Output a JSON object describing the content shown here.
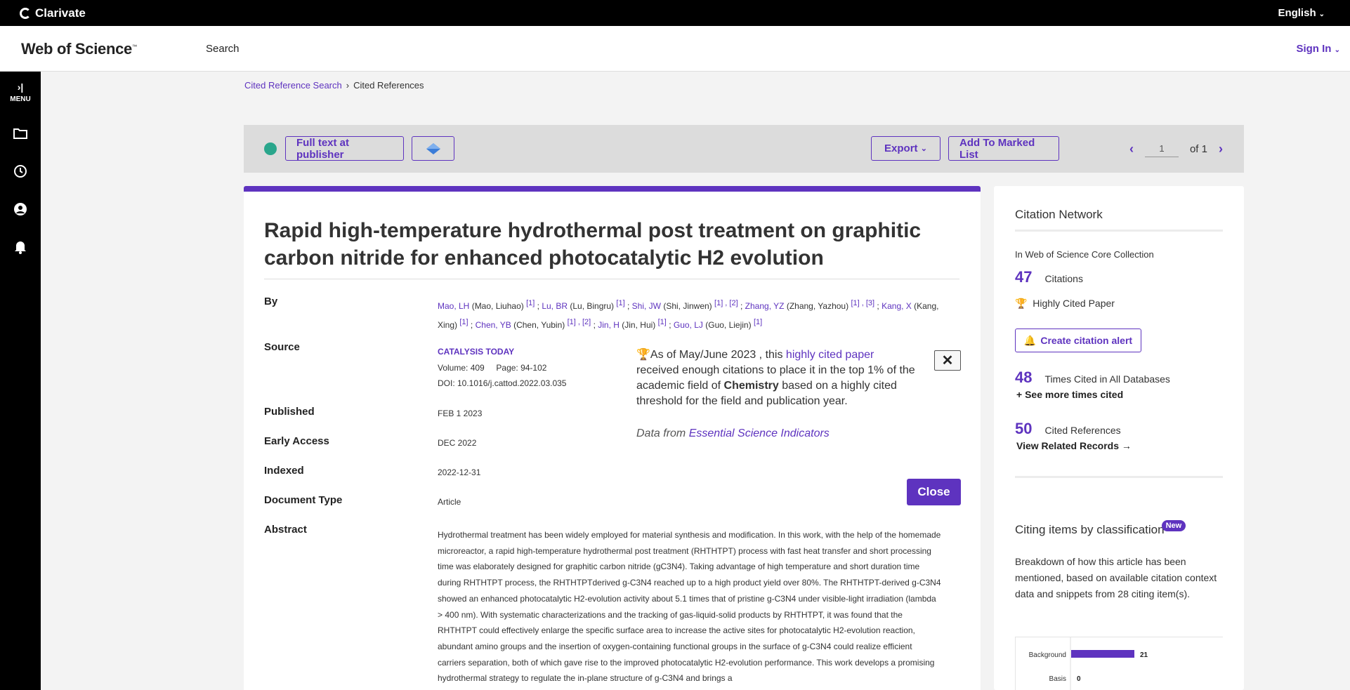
{
  "topbar": {
    "brand": "Clarivate",
    "language": "English"
  },
  "header": {
    "logo": "Web of Science",
    "logo_tm": "™",
    "search": "Search",
    "sign_in": "Sign In"
  },
  "sidebar": {
    "menu_label": "MENU",
    "icons": [
      "folder-icon",
      "history-icon",
      "account-icon",
      "bell-icon"
    ]
  },
  "breadcrumb": {
    "items": [
      "Cited Reference Search",
      "Cited References"
    ]
  },
  "toolbar": {
    "full_text": "Full text at publisher",
    "export": "Export",
    "add_marked": "Add To Marked List",
    "page_value": "1",
    "page_of": "of 1"
  },
  "record": {
    "title": "Rapid high-temperature hydrothermal post treatment on graphitic carbon nitride for enhanced photocatalytic H2 evolution",
    "labels": {
      "by": "By",
      "source": "Source",
      "published": "Published",
      "early_access": "Early Access",
      "indexed": "Indexed",
      "doc_type": "Document Type",
      "abstract": "Abstract"
    },
    "authors": [
      {
        "short": "Mao, LH",
        "full": "(Mao, Liuhao)",
        "refs": "[1]"
      },
      {
        "short": "Lu, BR",
        "full": "(Lu, Bingru)",
        "refs": "[1]"
      },
      {
        "short": "Shi, JW",
        "full": "(Shi, Jinwen)",
        "refs": "[1] , [2]"
      },
      {
        "short": "Zhang, YZ",
        "full": "(Zhang, Yazhou)",
        "refs": "[1] , [3]"
      },
      {
        "short": "Kang, X",
        "full": "(Kang, Xing)",
        "refs": "[1]"
      },
      {
        "short": "Chen, YB",
        "full": "(Chen, Yubin)",
        "refs": "[1] , [2]"
      },
      {
        "short": "Jin, H",
        "full": "(Jin, Hui)",
        "refs": "[1]"
      },
      {
        "short": "Guo, LJ",
        "full": "(Guo, Liejin)",
        "refs": "[1]"
      }
    ],
    "journal": "CATALYSIS TODAY",
    "volume": "Volume: 409",
    "pages": "Page: 94-102",
    "doi": "DOI: 10.1016/j.cattod.2022.03.035",
    "published": "FEB 1 2023",
    "early_access": "DEC 2022",
    "indexed": "2022-12-31",
    "doc_type": "Article",
    "abstract": "Hydrothermal treatment has been widely employed for material synthesis and modification. In this work, with the help of the homemade microreactor, a rapid high-temperature hydrothermal post treatment (RHTHTPT) process with fast heat transfer and short processing time was elaborately designed for graphitic carbon nitride (gC3N4). Taking advantage of high temperature and short duration time during RHTHTPT process, the RHTHTPTderived g-C3N4 reached up to a high product yield over 80%. The RHTHTPT-derived g-C3N4 showed an enhanced photocatalytic H2-evolution activity about 5.1 times that of pristine g-C3N4 under visible-light irradiation (lambda > 400 nm). With systematic characterizations and the tracking of gas-liquid-solid products by RHTHTPT, it was found that the RHTHTPT could effectively enlarge the specific surface area to increase the active sites for photocatalytic H2-evolution reaction, abundant amino groups and the insertion of oxygen-containing functional groups in the surface of g-C3N4 could realize efficient carriers separation, both of which gave rise to the improved photocatalytic H2-evolution performance. This work develops a promising hydrothermal strategy to regulate the in-plane structure of g-C3N4 and brings a"
  },
  "highly_cited_popup": {
    "lead": "As of May/June 2023 , this ",
    "link": "highly cited paper",
    "mid": " received enough citations to place it in the top 1% of the academic field of ",
    "field": "Chemistry",
    "tail": " based on a highly cited threshold for the field and publication year.",
    "data_from": "Data from ",
    "esi": "Essential Science Indicators",
    "close_x": "✕",
    "close": "Close"
  },
  "citation_network": {
    "title": "Citation Network",
    "collection": "In Web of Science Core Collection",
    "citations_num": "47",
    "citations_label": "Citations",
    "highly_cited": "Highly Cited Paper",
    "create_alert": "Create citation alert",
    "times_cited_num": "48",
    "times_cited_label": "Times Cited in All Databases",
    "see_more": "+  See more times cited",
    "cited_refs_num": "50",
    "cited_refs_label": "Cited References",
    "view_related": "View Related Records →",
    "classification_title": "Citing items by classification",
    "new_badge": "New",
    "classification_desc": "Breakdown of how this article has been mentioned, based on available citation context data and snippets from 28 citing item(s)."
  },
  "chart_data": {
    "type": "bar",
    "categories": [
      "Background",
      "Basis"
    ],
    "values": [
      21,
      0
    ],
    "title": "",
    "xlabel": "",
    "ylabel": ""
  },
  "colors": {
    "accent": "#5e33bf",
    "topbar": "#000000",
    "open_access": "#2aa68c",
    "trophy": "#b22a00"
  }
}
